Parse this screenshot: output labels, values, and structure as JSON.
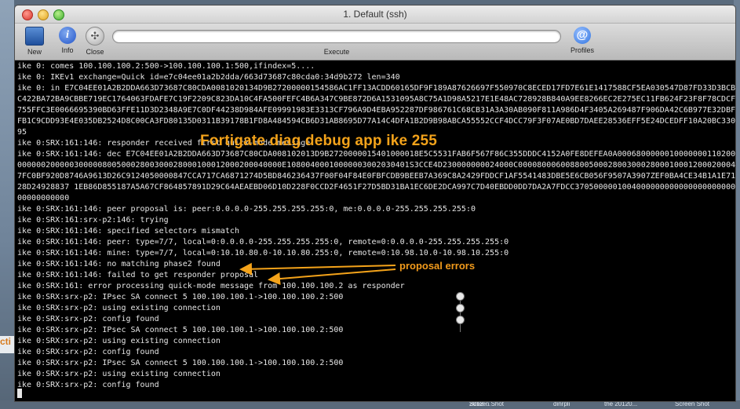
{
  "window": {
    "title": "1. Default (ssh)"
  },
  "toolbar": {
    "new_label": "New",
    "info_label": "Info",
    "close_label": "Close",
    "execute_label": "Execute",
    "profiles_label": "Profiles",
    "command_value": ""
  },
  "annotations": {
    "title": "Fortigate  diag debug app ike  255",
    "errors": "proposal errors"
  },
  "terminal": {
    "lines": [
      "ike 0: comes 100.100.100.2:500->100.100.100.1:500,ifindex=5....",
      "ike 0: IKEv1 exchange=Quick id=e7c04ee01a2b2dda/663d73687c80cda0:34d9b272 len=340",
      "ike 0: in E7C04EE01A2B2DDA663D73687C80CDA0081020134D9B27200000154586AC1FF13ACDD60165DF9F189A87626697F550970C8ECED17FD7E61E1417588CF5EA030547D87FD33D3BCB0D6F6AFE",
      "C422BA72BA9CBBE719EC1764063FDAFE7C19F2209C823DA10C4FA500FEFC4B6A347C9BE872D6A1531095A8C75A1D98A5217E1E48AC728928B840A9EE8266EC2E275EC11FB624F23F8F78CDCF57781CDC2",
      "755FFC3E0066695390BD63FFE11D3D2348A9E7C0DF44238D984AFE09991983E3313CF796A9D4EBA952287DF986761C68CB31A3A30AB090F811A986D4F3405A269487F906DA42C6B977E32DBF344471CA",
      "FB1C9CDD93E4E035DB2524D8C00CA3FD80135D0311B39178B1FD8A484594CB6D31AB8695D77A14C4DFA1B2D9B98ABCA55552CCF4DCC79F3F07AE0BD7DAEE28536EFF5E24DCEDFF10A20BC330F9456C",
      "95",
      "ike 0:SRX:161:146: responder received first quick-mode message",
      "ike 0:SRX:161:146: dec E7C04EE01A2B2DDA663D73687C80CDA008102013D9B2720000015401000018E5C5531FAB6F567F86C355DDDC4152A0FE8DEFEA0A0006800000010000000110200002C010301",
      "00000020000030000080050002800300028000100012000200040000E10800400010000003002030401S3CCE4D230000000024000C00008000600880050002800300028000100012000200040000E108004000100",
      "7FC0BF920D8746A9613D26C9124050000847CCA717CA6871274D5BD846236437F00F04F84E0FBFCDB9BEEB7A369C8A2429FDDCF1AF5541483DBE5E6CB056F9507A3907ZEF0BA4CE34B1A1E719AA45A4E",
      "28D24928837 1EB86D855187A5A67CF864857891D29C64AEAEBD06D10D228F0CCD2F4651F27D5BD31BA1EC6DE2DCA997C7D40EBDD0DD7DA2A7FDCC37050000010040000000000000000000000000000000",
      "00000000000",
      "ike 0:SRX:161:146: peer proposal is: peer:0.0.0.0-255.255.255.255:0, me:0.0.0.0-255.255.255.255:0",
      "ike 0:SRX:161:srx-p2:146: trying",
      "ike 0:SRX:161:146: specified selectors mismatch",
      "ike 0:SRX:161:146: peer: type=7/7, local=0:0.0.0.0-255.255.255.255:0, remote=0:0.0.0.0-255.255.255.255:0",
      "ike 0:SRX:161:146: mine: type=7/7, local=0:10.10.80.0-10.10.80.255:0, remote=0:10.98.10.0-10.98.10.255:0",
      "ike 0:SRX:161:146: no matching phase2 found",
      "ike 0:SRX:161:146: failed to get responder proposal",
      "ike 0:SRX:161: error processing quick-mode message from 100.100.100.2 as responder",
      "ike 0:SRX:srx-p2: IPsec SA connect 5 100.100.100.1->100.100.100.2:500",
      "ike 0:SRX:srx-p2: using existing connection",
      "ike 0:SRX:srx-p2: config found",
      "ike 0:SRX:srx-p2: IPsec SA connect 5 100.100.100.1->100.100.100.2:500",
      "ike 0:SRX:srx-p2: using existing connection",
      "ike 0:SRX:srx-p2: config found",
      "ike 0:SRX:srx-p2: IPsec SA connect 5 100.100.100.1->100.100.100.2:500",
      "ike 0:SRX:srx-p2: using existing connection",
      "ike 0:SRX:srx-p2: config found"
    ]
  },
  "colors": {
    "annotation": "#f4a31a",
    "terminal_text": "#e6e6e6",
    "terminal_bg": "#000000"
  },
  "desktop": {
    "left_fragment": "cti",
    "bottom_labels": [
      "Screen Shot",
      "2012-...",
      "dinrpli",
      "the 20120...",
      "Screen Shot"
    ]
  }
}
